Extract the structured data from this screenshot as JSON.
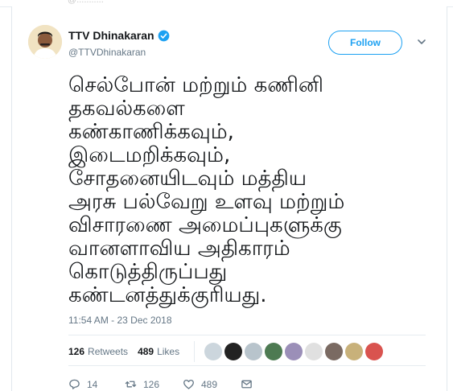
{
  "header_fragment": "@...........",
  "user": {
    "name": "TTV Dhinakaran",
    "handle": "@TTVDhinakaran",
    "verified": true
  },
  "follow_label": "Follow",
  "tweet_lines": [
    "செல்போன் மற்றும் கணினி",
    "தகவல்களை",
    "கண்காணிக்கவும்,",
    "இடைமறிக்கவும்,",
    "சோதனையிடவும் மத்திய",
    "அரசு பல்வேறு உளவு மற்றும்",
    "விசாரணை அமைப்புகளுக்கு",
    "வானளாவிய அதிகாரம்",
    "கொடுத்திருப்பது",
    "கண்டனத்துக்குரியது."
  ],
  "timestamp": "11:54 AM - 23 Dec 2018",
  "stats": {
    "retweets_count": "126",
    "retweets_label": "Retweets",
    "likes_count": "489",
    "likes_label": "Likes"
  },
  "actions": {
    "replies": "14",
    "retweets": "126",
    "likes": "489"
  },
  "icons": [
    "verified-icon",
    "chevron-down-icon",
    "reply-icon",
    "retweet-icon",
    "like-icon",
    "message-icon"
  ],
  "colors": {
    "accent": "#1da1f2",
    "text": "#14171a",
    "muted": "#657786"
  }
}
